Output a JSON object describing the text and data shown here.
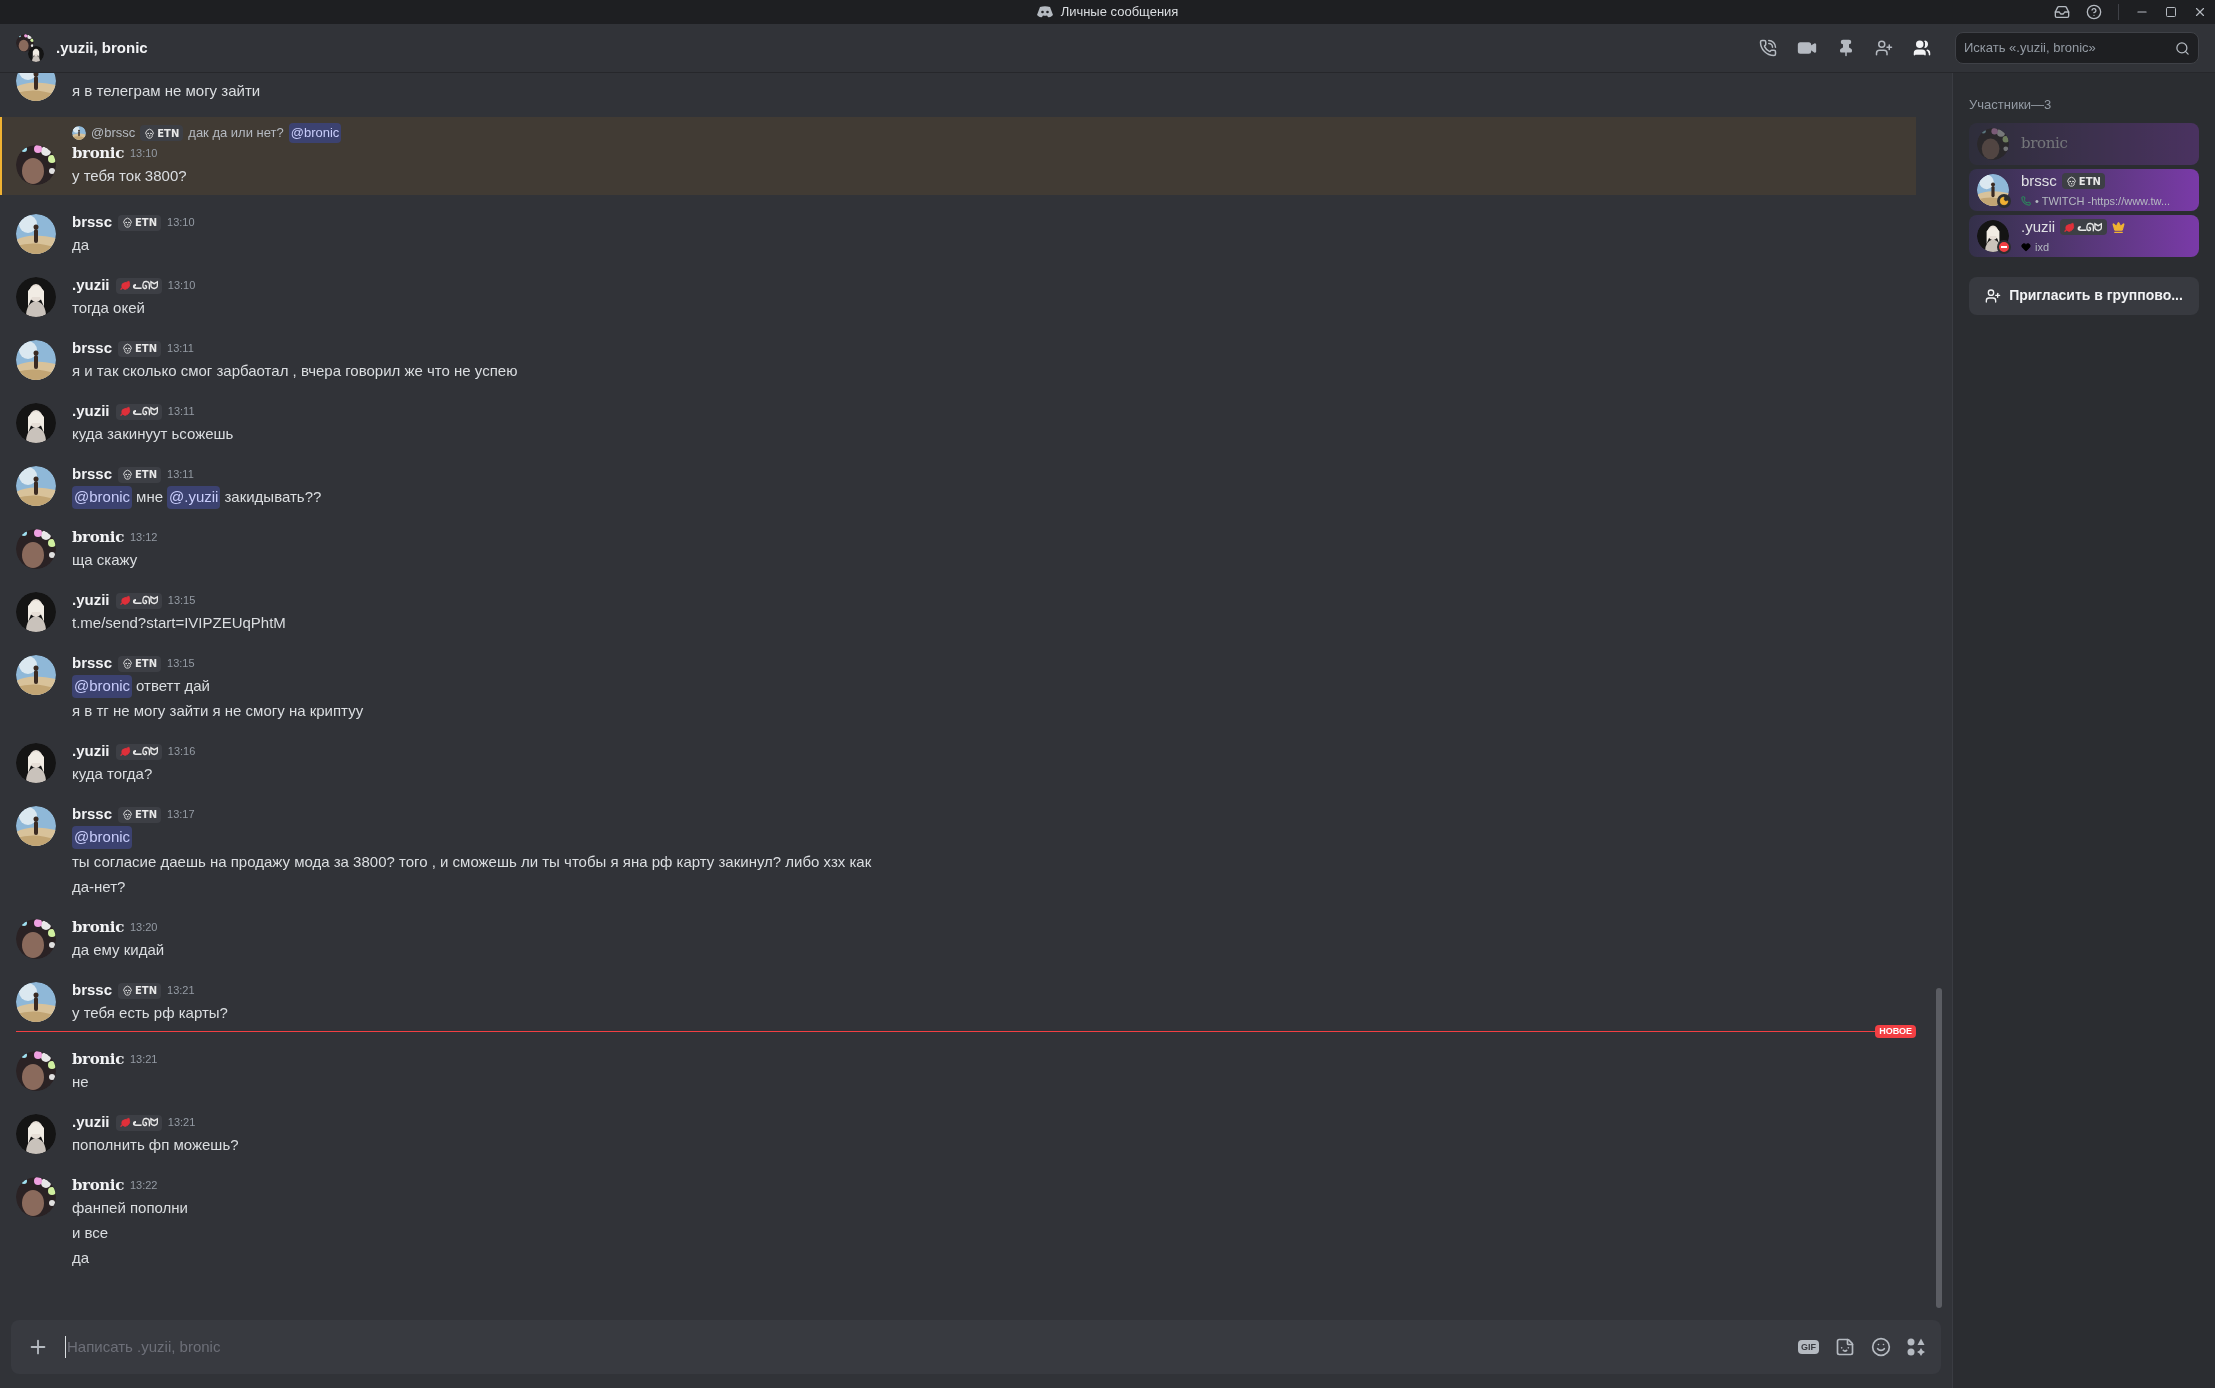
{
  "window": {
    "title": "Личные сообщения"
  },
  "header": {
    "title": ".yuzii, bronic",
    "search": {
      "placeholder": "Искать «.yuzii, bronic»"
    }
  },
  "messages": [
    {
      "kind": "cut",
      "lines": [
        [
          {
            "kind": "text",
            "text": "я в телеграм не могу зайти"
          }
        ]
      ]
    },
    {
      "kind": "message",
      "highlighted": true,
      "author": "bronic",
      "display_font": true,
      "time": "13:10",
      "reply": {
        "author": "@brssc",
        "tag": {
          "kind": "skull",
          "text": "ETN"
        },
        "parts": [
          {
            "kind": "text",
            "text": "дак да или нет?"
          },
          {
            "kind": "mention",
            "text": "@bronic"
          }
        ]
      },
      "lines": [
        [
          {
            "kind": "text",
            "text": "у тебя ток 3800?"
          }
        ]
      ]
    },
    {
      "kind": "message",
      "highlighted": false,
      "author": "brssc",
      "display_font": false,
      "tag": {
        "kind": "skull",
        "text": "ETN"
      },
      "time": "13:10",
      "lines": [
        [
          {
            "kind": "text",
            "text": "да"
          }
        ]
      ]
    },
    {
      "kind": "message",
      "highlighted": false,
      "author": ".yuzii",
      "display_font": false,
      "tag": {
        "kind": "leaf",
        "text": "ᓚᘏᗢ"
      },
      "time": "13:10",
      "lines": [
        [
          {
            "kind": "text",
            "text": "тогда окей"
          }
        ]
      ]
    },
    {
      "kind": "message",
      "highlighted": false,
      "author": "brssc",
      "display_font": false,
      "tag": {
        "kind": "skull",
        "text": "ETN"
      },
      "time": "13:11",
      "lines": [
        [
          {
            "kind": "text",
            "text": "я и так сколько смог зарбаотал , вчера говорил же что не успею"
          }
        ]
      ]
    },
    {
      "kind": "message",
      "highlighted": false,
      "author": ".yuzii",
      "display_font": false,
      "tag": {
        "kind": "leaf",
        "text": "ᓚᘏᗢ"
      },
      "time": "13:11",
      "lines": [
        [
          {
            "kind": "text",
            "text": "куда закинуут ьсожешь"
          }
        ]
      ]
    },
    {
      "kind": "message",
      "highlighted": false,
      "author": "brssc",
      "display_font": false,
      "tag": {
        "kind": "skull",
        "text": "ETN"
      },
      "time": "13:11",
      "lines": [
        [
          {
            "kind": "mention",
            "text": "@bronic"
          },
          {
            "kind": "text",
            "text": "мне"
          },
          {
            "kind": "mention",
            "text": "@.yuzii"
          },
          {
            "kind": "text",
            "text": "закидывать??"
          }
        ]
      ]
    },
    {
      "kind": "message",
      "highlighted": false,
      "author": "bronic",
      "display_font": true,
      "time": "13:12",
      "lines": [
        [
          {
            "kind": "text",
            "text": "ща скажу"
          }
        ]
      ]
    },
    {
      "kind": "message",
      "highlighted": false,
      "author": ".yuzii",
      "display_font": false,
      "tag": {
        "kind": "leaf",
        "text": "ᓚᘏᗢ"
      },
      "time": "13:15",
      "lines": [
        [
          {
            "kind": "text",
            "text": "t.me/send?start=IVIPZEUqPhtM"
          }
        ]
      ]
    },
    {
      "kind": "message",
      "highlighted": false,
      "author": "brssc",
      "display_font": false,
      "tag": {
        "kind": "skull",
        "text": "ETN"
      },
      "time": "13:15",
      "lines": [
        [
          {
            "kind": "mention",
            "text": "@bronic"
          },
          {
            "kind": "text",
            "text": "ответт дай"
          }
        ],
        [
          {
            "kind": "text",
            "text": "я в тг не могу зайти я не смогу на криптуу"
          }
        ]
      ]
    },
    {
      "kind": "message",
      "highlighted": false,
      "author": ".yuzii",
      "display_font": false,
      "tag": {
        "kind": "leaf",
        "text": "ᓚᘏᗢ"
      },
      "time": "13:16",
      "lines": [
        [
          {
            "kind": "text",
            "text": "куда тогда?"
          }
        ]
      ]
    },
    {
      "kind": "message",
      "highlighted": false,
      "author": "brssc",
      "display_font": false,
      "tag": {
        "kind": "skull",
        "text": "ETN"
      },
      "time": "13:17",
      "lines": [
        [
          {
            "kind": "mention",
            "text": "@bronic"
          }
        ],
        [
          {
            "kind": "text",
            "text": "ты согласие даешь на продажу мода за 3800? того  , и сможешь ли ты чтобы я яна рф карту закинул? либо хзх как"
          }
        ],
        [
          {
            "kind": "text",
            "text": "да-нет?"
          }
        ]
      ]
    },
    {
      "kind": "message",
      "highlighted": false,
      "author": "bronic",
      "display_font": true,
      "time": "13:20",
      "lines": [
        [
          {
            "kind": "text",
            "text": "да ему кидай"
          }
        ]
      ]
    },
    {
      "kind": "message",
      "highlighted": false,
      "author": "brssc",
      "display_font": false,
      "tag": {
        "kind": "skull",
        "text": "ETN"
      },
      "time": "13:21",
      "lines": [
        [
          {
            "kind": "text",
            "text": "у тебя есть рф карты?"
          }
        ]
      ]
    },
    {
      "kind": "divider",
      "label": "НОВОЕ"
    },
    {
      "kind": "message",
      "highlighted": false,
      "author": "bronic",
      "display_font": true,
      "time": "13:21",
      "lines": [
        [
          {
            "kind": "text",
            "text": "не"
          }
        ]
      ]
    },
    {
      "kind": "message",
      "highlighted": false,
      "author": ".yuzii",
      "display_font": false,
      "tag": {
        "kind": "leaf",
        "text": "ᓚᘏᗢ"
      },
      "time": "13:21",
      "lines": [
        [
          {
            "kind": "text",
            "text": "пополнить фп можешь?"
          }
        ]
      ]
    },
    {
      "kind": "message",
      "highlighted": false,
      "author": "bronic",
      "display_font": true,
      "time": "13:22",
      "lines": [
        [
          {
            "kind": "text",
            "text": "фанпей пополни"
          }
        ],
        [
          {
            "kind": "text",
            "text": "и все"
          }
        ],
        [
          {
            "kind": "text",
            "text": "да"
          }
        ]
      ]
    }
  ],
  "composer": {
    "placeholder": "Написать .yuzii, bronic",
    "gif_label": "GIF"
  },
  "members": {
    "heading": "Участники—3",
    "items": [
      {
        "name": "bronic",
        "display_font": true,
        "kind": "offline",
        "owner": false
      },
      {
        "name": "brssc",
        "display_font": false,
        "kind": "idle",
        "owner": false,
        "tag": {
          "kind": "skull",
          "text": "ETN"
        },
        "activity": {
          "kind": "call",
          "text": "• TWITCH -https://www.tw..."
        }
      },
      {
        "name": ".yuzii",
        "display_font": false,
        "kind": "dnd",
        "owner": true,
        "tag": {
          "kind": "leaf",
          "text": "ᓚᘏᗢ"
        },
        "activity": {
          "kind": "heart",
          "text": "ixd"
        }
      }
    ],
    "invite_label": "Пригласить в группово..."
  }
}
